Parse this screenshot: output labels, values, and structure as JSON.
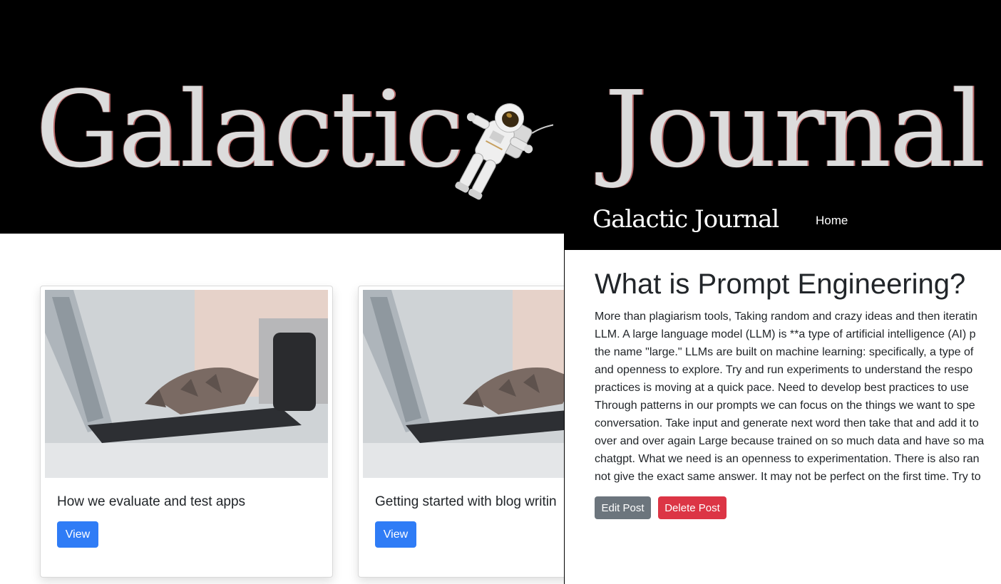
{
  "hero": {
    "word1": "Galactic",
    "word2": "Journal"
  },
  "cards": [
    {
      "title": "How we evaluate and test apps",
      "button": "View"
    },
    {
      "title": "Getting started with blog writin",
      "button": "View"
    }
  ],
  "overlay": {
    "brand": "Galactic Journal",
    "nav_home": "Home",
    "post_title": "What is Prompt Engineering?",
    "post_lines": [
      "More than plagiarism tools, Taking random and crazy ideas and then iteratin",
      "LLM. A large language model (LLM) is **a type of artificial intelligence (AI) p",
      "the name \"large.\" LLMs are built on machine learning: specifically, a type of",
      "and openness to explore. Try and run experiments to understand the respo",
      "practices is moving at a quick pace. Need to develop best practices to use",
      "Through patterns in our prompts we can focus on the things we want to spe",
      "conversation. Take input and generate next word then take that and add it to",
      "over and over again Large because trained on so much data and have so ma",
      "chatgpt. What we need is an openness to experimentation. There is also ran",
      "not give the exact same answer. It may not be perfect on the first time. Try to"
    ],
    "edit_label": "Edit Post",
    "delete_label": "Delete Post"
  },
  "colors": {
    "primary": "#2f7cf6",
    "secondary": "#6c757d",
    "danger": "#dc3545",
    "nav_bg": "#000000"
  }
}
